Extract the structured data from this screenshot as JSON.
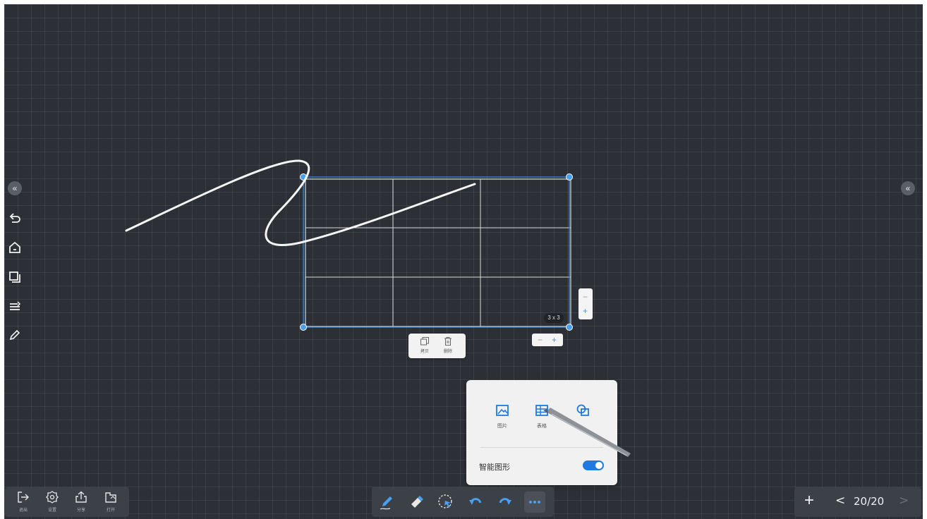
{
  "left_sidebar": {
    "collapse_glyph": "«",
    "tools": [
      {
        "icon": "undo-icon"
      },
      {
        "icon": "home-icon"
      },
      {
        "icon": "pages-icon"
      },
      {
        "icon": "menu-lines-icon"
      },
      {
        "icon": "pencil-icon"
      }
    ]
  },
  "right_sidebar": {
    "collapse_glyph": "«"
  },
  "table_object": {
    "rows": 3,
    "cols": 3,
    "size_tag": "3 x 3",
    "row_stepper": {
      "minus": "−",
      "plus": "+"
    },
    "col_stepper": {
      "minus": "−",
      "plus": "+"
    },
    "selection_color": "#3a86d6"
  },
  "table_menu": {
    "items": [
      {
        "label": "拷贝",
        "icon": "copy-icon"
      },
      {
        "label": "删除",
        "icon": "trash-icon"
      }
    ]
  },
  "insert_panel": {
    "options": [
      {
        "label": "图片",
        "icon": "image-icon"
      },
      {
        "label": "表格",
        "icon": "table-icon"
      },
      {
        "label": "",
        "icon": "shapes-icon"
      }
    ],
    "smart_shape_label": "智能图形",
    "smart_shape_enabled": true,
    "accent": "#1f7ae0"
  },
  "bottom_left_toolbar": {
    "items": [
      {
        "label": "退出",
        "icon": "exit-icon"
      },
      {
        "label": "设置",
        "icon": "settings-icon"
      },
      {
        "label": "分享",
        "icon": "share-icon"
      },
      {
        "label": "打开",
        "icon": "open-folder-icon"
      }
    ]
  },
  "bottom_center_toolbar": {
    "items": [
      {
        "icon": "pen-icon"
      },
      {
        "icon": "eraser-icon"
      },
      {
        "icon": "lasso-select-icon"
      },
      {
        "icon": "undo-icon"
      },
      {
        "icon": "redo-icon"
      },
      {
        "icon": "more-icon",
        "active": true
      }
    ],
    "accent": "#4a9ff0"
  },
  "bottom_right_toolbar": {
    "add_glyph": "+",
    "prev_glyph": "<",
    "next_glyph": ">",
    "page_indicator": "20/20"
  }
}
